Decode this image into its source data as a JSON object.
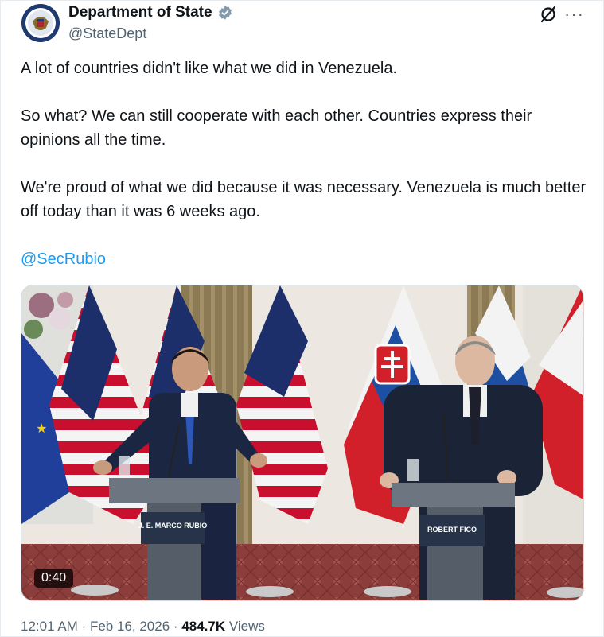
{
  "author": {
    "name": "Department of State",
    "handle": "@StateDept"
  },
  "tweet": {
    "paragraphs": [
      "A lot of countries didn't like what we did in Venezuela.",
      "So what? We can still cooperate with each other. Countries express their opinions all the time.",
      "We're proud of what we did because it was necessary. Venezuela is much better off today than it was 6 weeks ago."
    ],
    "mention": "@SecRubio"
  },
  "media": {
    "duration": "0:40",
    "podium_left_label": "J. E. MARCO RUBIO",
    "podium_right_label": "ROBERT FICO"
  },
  "meta": {
    "time": "12:01 AM",
    "date": "Feb 16, 2026",
    "views_count": "484.7K",
    "views_label": "Views",
    "sep": "·"
  },
  "colors": {
    "accent": "#1d9bf0",
    "verified": "#829aab"
  }
}
